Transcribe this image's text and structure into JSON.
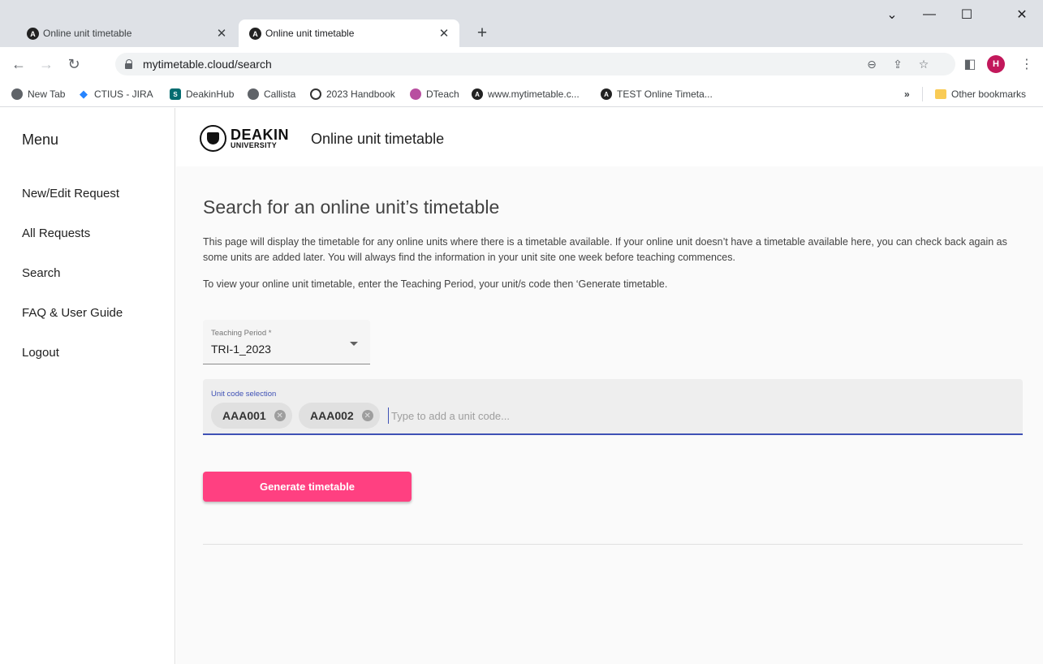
{
  "browser": {
    "tabs": [
      {
        "title": "Online unit timetable",
        "favicon": "A"
      },
      {
        "title": "Online unit timetable",
        "favicon": "A"
      }
    ],
    "new_tab": "+",
    "window": {
      "dropdown": "⌄",
      "minimize": "—",
      "maximize": "☐",
      "close": "✕"
    },
    "url": "mytimetable.cloud/search",
    "profile_initial": "H",
    "bookmarks": [
      {
        "label": "New Tab"
      },
      {
        "label": "CTIUS - JIRA"
      },
      {
        "label": "DeakinHub"
      },
      {
        "label": "Callista"
      },
      {
        "label": "2023 Handbook"
      },
      {
        "label": "DTeach"
      },
      {
        "label": "www.mytimetable.c..."
      },
      {
        "label": "TEST Online Timeta..."
      }
    ],
    "overflow": "»",
    "other_bookmarks": "Other bookmarks"
  },
  "sidebar": {
    "title": "Menu",
    "items": [
      {
        "label": "New/Edit Request"
      },
      {
        "label": "All Requests"
      },
      {
        "label": "Search"
      },
      {
        "label": "FAQ & User Guide"
      },
      {
        "label": "Logout"
      }
    ]
  },
  "header": {
    "logo_line1": "DEAKIN",
    "logo_line2": "UNIVERSITY",
    "title": "Online unit timetable"
  },
  "main": {
    "heading": "Search for an online unit’s timetable",
    "intro": "This page will display the timetable for any online units where there is a timetable available. If your online unit doesn’t have a timetable available here, you can check back again as some units are added later. You will always find the information in your unit site one week before teaching commences.",
    "instructions": "To view your online unit timetable, enter the Teaching Period, your unit/s code then ‘Generate timetable.",
    "teaching_period": {
      "label": "Teaching Period *",
      "value": "TRI-1_2023"
    },
    "unit_codes": {
      "label": "Unit code selection",
      "chips": [
        "AAA001",
        "AAA002"
      ],
      "placeholder": "Type to add a unit code...",
      "value": ""
    },
    "generate_label": "Generate timetable"
  },
  "colors": {
    "accent": "#ff4081",
    "primary": "#3f51b5",
    "profile": "#c2185b"
  }
}
